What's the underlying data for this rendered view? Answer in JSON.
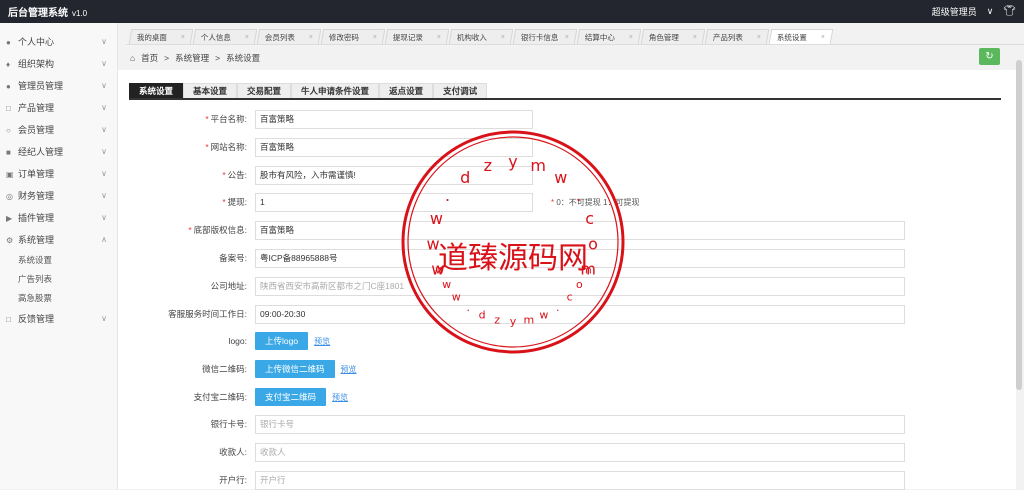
{
  "app": {
    "title": "后台管理系统",
    "version": "v1.0",
    "user": "超级管理员",
    "user_caret": "∨"
  },
  "sidebar": {
    "items": [
      {
        "icon": "user-icon",
        "label": "个人中心"
      },
      {
        "icon": "org-icon",
        "label": "组织架构"
      },
      {
        "icon": "admin-icon",
        "label": "管理员管理"
      },
      {
        "icon": "product-icon",
        "label": "产品管理"
      },
      {
        "icon": "member-icon",
        "label": "会员管理"
      },
      {
        "icon": "broker-icon",
        "label": "经纪人管理"
      },
      {
        "icon": "order-icon",
        "label": "订单管理"
      },
      {
        "icon": "finance-icon",
        "label": "财务管理"
      },
      {
        "icon": "plugin-icon",
        "label": "插件管理"
      },
      {
        "icon": "system-icon",
        "label": "系统管理"
      }
    ],
    "sub_items": [
      "系统设置",
      "广告列表",
      "高急股票"
    ],
    "feedback": {
      "icon": "feedback-icon",
      "label": "反馈管理"
    }
  },
  "tabs": [
    "我的桌面",
    "个人信息",
    "会员列表",
    "修改密码",
    "提现记录",
    "机构收入",
    "银行卡信息",
    "结算中心",
    "角色管理",
    "产品列表",
    "系统设置"
  ],
  "breadcrumb": {
    "home": "首页",
    "sep": ">",
    "level1": "系统管理",
    "level2": "系统设置"
  },
  "subtabs": [
    "系统设置",
    "基本设置",
    "交易配置",
    "牛人申请条件设置",
    "返点设置",
    "支付调试"
  ],
  "form": {
    "platform_name": {
      "label": "平台名称:",
      "value": "百富策略"
    },
    "site_name": {
      "label": "网站名称:",
      "value": "百富策略"
    },
    "notice": {
      "label": "公告:",
      "value": "股市有风险，入市需谨慎!"
    },
    "withdraw": {
      "label": "提现:",
      "value": "1",
      "hint": "0：不可提现 1：可提现"
    },
    "copyright": {
      "label": "底部版权信息:",
      "value": "百富策略"
    },
    "icp": {
      "label": "备案号:",
      "value": "粤ICP备88965888号"
    },
    "address": {
      "label": "公司地址:",
      "value": "陕西省西安市高新区都市之门C座1801"
    },
    "service_time": {
      "label": "客服服务时间工作日:",
      "value": "09:00-20:30"
    },
    "logo": {
      "label": "logo:",
      "button": "上传logo",
      "preview": "预览"
    },
    "wechat_qr": {
      "label": "微信二维码:",
      "button": "上传微信二维码",
      "preview": "预览"
    },
    "alipay_qr": {
      "label": "支付宝二维码:",
      "button": "支付宝二维码",
      "preview": "预览"
    },
    "bank_card": {
      "label": "银行卡号:",
      "placeholder": "银行卡号"
    },
    "payee": {
      "label": "收款人:",
      "placeholder": "收款人"
    },
    "bank": {
      "label": "开户行:",
      "placeholder": "开户行"
    }
  },
  "watermark": {
    "center": "道臻源码网",
    "letters": [
      "w",
      "w",
      "w",
      ".",
      "d",
      "z",
      "y",
      "m",
      "w",
      ".",
      "c",
      "o",
      "m"
    ],
    "color": "#d9121a"
  },
  "colors": {
    "topbar": "#23262e",
    "primary_button": "#3aa8e6",
    "refresh": "#5cb85c",
    "required": "#e33333"
  }
}
